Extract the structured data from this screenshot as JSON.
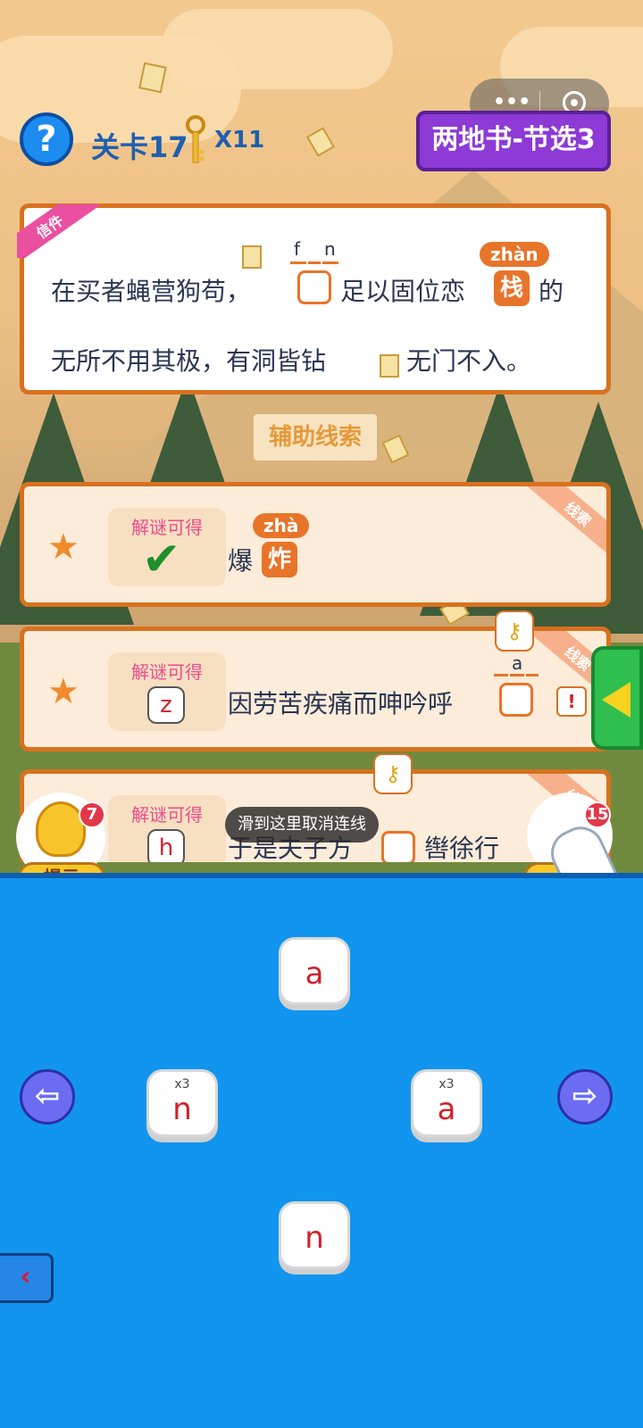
{
  "header": {
    "help_icon": "?",
    "level_label": "关卡17",
    "key_count": "X11",
    "chapter_title": "两地书-节选3"
  },
  "letter": {
    "ribbon": "信件",
    "line1_a": "在买者蝇营狗苟，",
    "blank_hint_1": "f",
    "blank_hint_2": "n",
    "line1_b": "足以固位恋",
    "hl_char": "栈",
    "hl_pinyin": "zhàn",
    "line1_c": "的",
    "line2_a": "无所不用其极，有洞皆钻",
    "line2_b": "无门不入。"
  },
  "aux_label": "辅助线索",
  "clues": [
    {
      "tag": "线索",
      "reward_label": "解谜可得",
      "reward_key": "",
      "text": "爆",
      "hl_char": "炸",
      "hl_pinyin": "zhà",
      "solved": true
    },
    {
      "tag": "线索",
      "reward_label": "解谜可得",
      "reward_key": "z",
      "text": "因劳苦疾痛而呻吟呼",
      "blank_hint": "a",
      "warn": "!"
    },
    {
      "tag": "线索",
      "reward_label": "解谜可得",
      "reward_key": "h",
      "text_a": "于是夫子方",
      "text_b": "辔徐行"
    }
  ],
  "tooltip": "滑到这里取消连线",
  "hint_button": {
    "label": "提示",
    "badge": "7"
  },
  "clean_button": {
    "label": "消",
    "badge": "15"
  },
  "tiles": [
    {
      "char": "a",
      "mult": ""
    },
    {
      "char": "n",
      "mult": "x3"
    },
    {
      "char": "a",
      "mult": "x3"
    },
    {
      "char": "n",
      "mult": ""
    }
  ],
  "nav": {
    "left": "⇦",
    "right": "⇨",
    "back": "‹"
  },
  "colors": {
    "accent": "#e8742a",
    "panel": "#1195ef",
    "tile_text": "#d1202a",
    "chapter": "#8d3ad6"
  }
}
